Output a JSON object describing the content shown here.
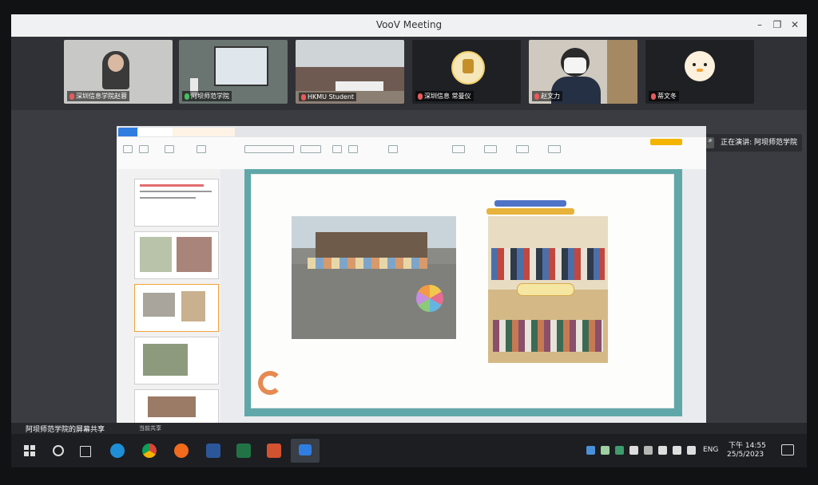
{
  "window": {
    "title": "VooV Meeting",
    "controls": {
      "minimize": "–",
      "maximize": "❐",
      "close": "✕"
    }
  },
  "participants": [
    {
      "name": "深圳信息学院赵蓉",
      "mic": "muted"
    },
    {
      "name": "阿坝师范学院",
      "mic": "on"
    },
    {
      "name": "HKMU Student",
      "mic": "muted"
    },
    {
      "name": "深圳信息 常曼仪",
      "mic": "muted"
    },
    {
      "name": "赵文力",
      "mic": "muted"
    },
    {
      "name": "蒂文冬",
      "mic": "muted"
    }
  ],
  "presenting": {
    "label": "正在演讲: 阿坝师范学院"
  },
  "share": {
    "label": "阿坝师范学院的屏幕共享",
    "sub": "当前共享"
  },
  "taskbar": {
    "lang": "ENG",
    "time": "下午 14:55",
    "date": "25/5/2023"
  },
  "colors": {
    "accent": "#2f7de1",
    "slide_frame": "#5fa7a9",
    "ppt_orange": "#d35230",
    "word_blue": "#2b579a",
    "excel_green": "#217346"
  }
}
